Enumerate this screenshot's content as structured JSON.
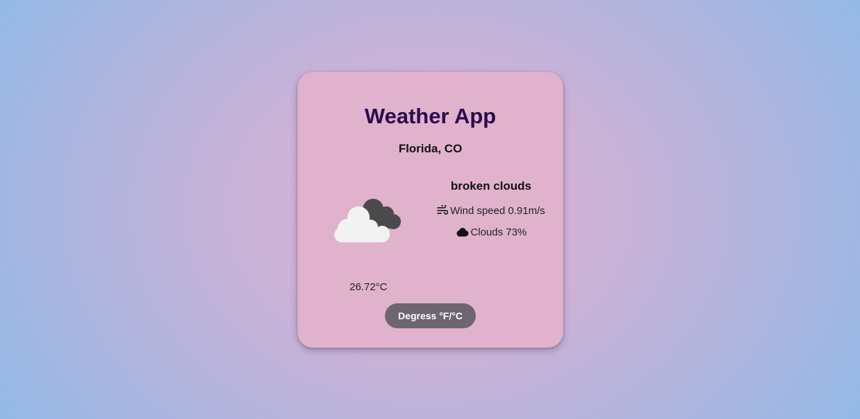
{
  "app": {
    "title": "Weather App"
  },
  "location": "Florida, CO",
  "weather": {
    "description": "broken clouds",
    "icon": "broken-clouds-icon",
    "temperature": "26.72°C",
    "wind_label": "Wind speed",
    "wind_value": "0.91m/s",
    "clouds_label": "Clouds",
    "clouds_value": "73%"
  },
  "controls": {
    "units_button_label": "Degress °F/°C"
  },
  "colors": {
    "title": "#2a0a4e",
    "card": "#e0b2cb",
    "button": "#6c6670"
  }
}
